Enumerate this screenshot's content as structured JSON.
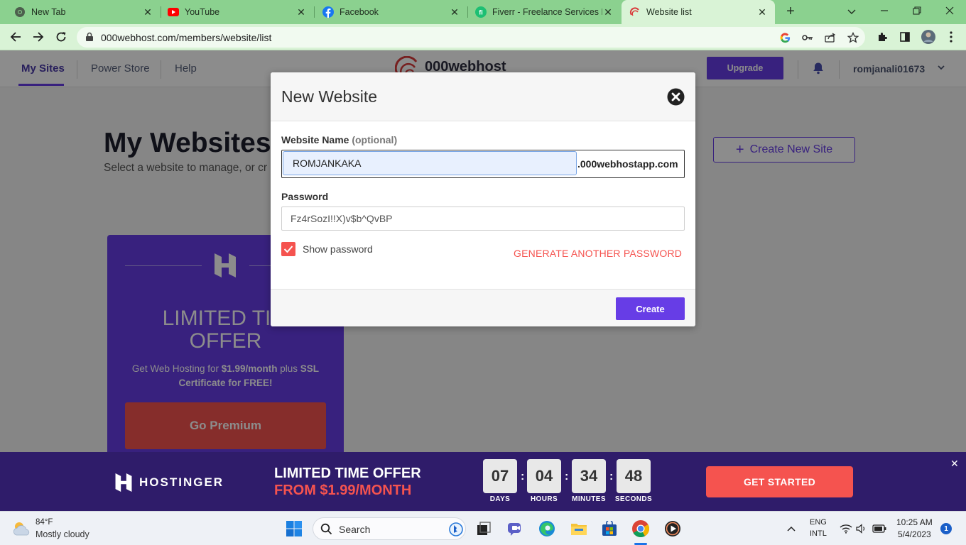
{
  "browser": {
    "tabs": [
      {
        "label": "New Tab",
        "icon": "chrome-icon"
      },
      {
        "label": "YouTube",
        "icon": "youtube-icon"
      },
      {
        "label": "Facebook",
        "icon": "facebook-icon"
      },
      {
        "label": "Fiverr - Freelance Services M",
        "icon": "fiverr-icon"
      },
      {
        "label": "Website list",
        "icon": "000webhost-icon",
        "active": true
      }
    ],
    "close_glyph": "✕",
    "new_tab_glyph": "+",
    "url": "000webhost.com/members/website/list"
  },
  "site": {
    "nav": [
      "My Sites",
      "Power Store",
      "Help"
    ],
    "logo_text": "000webhost",
    "upgrade_label": "Upgrade",
    "username": "romjanali01673",
    "page_title": "My Websites",
    "page_subtitle": "Select a website to manage, or cr",
    "create_site_label": "Create New Site",
    "create_site_plus": "+",
    "promo": {
      "title": "LIMITED TIM\nOFFER",
      "text_prefix": "Get Web Hosting for ",
      "text_price": "$1.99/month",
      "text_mid": " plus ",
      "text_ssl": "SSL Certificate for FREE!",
      "button_label": "Go Premium"
    }
  },
  "modal": {
    "title": "New Website",
    "name_label": "Website Name",
    "name_optional": "(optional)",
    "name_value": "ROMJANKAKA",
    "name_suffix": ".000webhostapp.com",
    "password_label": "Password",
    "password_value": "Fz4rSozI!!X)v$b^QvBP",
    "show_password_label": "Show password",
    "show_password_checked": true,
    "generate_label": "GENERATE ANOTHER PASSWORD",
    "create_label": "Create"
  },
  "banner": {
    "brand": "HOSTINGER",
    "line1": "LIMITED TIME OFFER",
    "line2": "FROM $1.99/MONTH",
    "countdown": [
      {
        "value": "07",
        "label": "DAYS"
      },
      {
        "value": "04",
        "label": "HOURS"
      },
      {
        "value": "34",
        "label": "MINUTES"
      },
      {
        "value": "48",
        "label": "SECONDS"
      }
    ],
    "colon": ":",
    "cta_label": "GET STARTED",
    "close_glyph": "✕"
  },
  "taskbar": {
    "weather_temp": "84°F",
    "weather_desc": "Mostly cloudy",
    "search_label": "Search",
    "lang_top": "ENG",
    "lang_bottom": "INTL",
    "time": "10:25 AM",
    "date": "5/4/2023",
    "notification_count": "1"
  },
  "colors": {
    "brand_purple": "#673de6",
    "accent_red": "#f5534f",
    "tab_strip": "#8bd18f",
    "banner_bg": "#2f1c6a"
  }
}
